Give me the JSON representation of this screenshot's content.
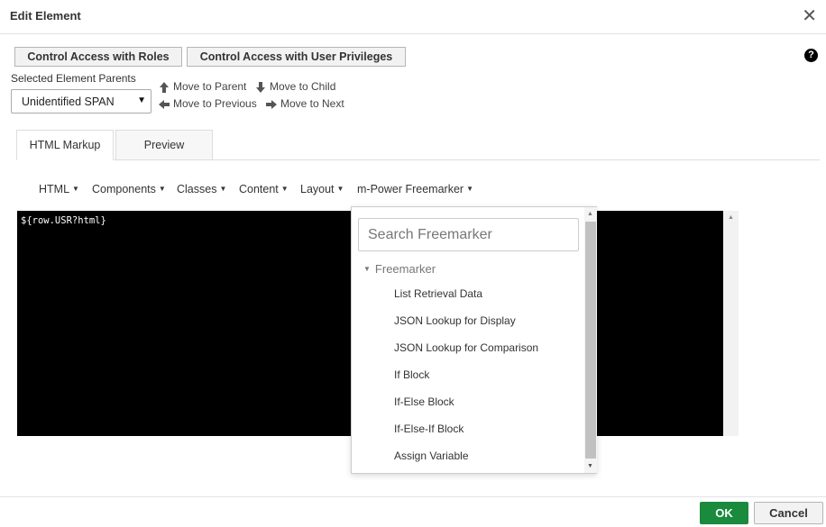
{
  "dialog": {
    "title": "Edit Element",
    "close_glyph": "✕"
  },
  "toolbar": {
    "roles_button": "Control Access with Roles",
    "privileges_button": "Control Access with User Privileges",
    "help_glyph": "?"
  },
  "parents": {
    "label": "Selected Element Parents",
    "selected": "Unidentified SPAN",
    "caret": "▼"
  },
  "moves": {
    "parent": "Move to Parent",
    "child": "Move to Child",
    "previous": "Move to Previous",
    "next": "Move to Next"
  },
  "tabs": {
    "html": "HTML Markup",
    "preview": "Preview",
    "active": "HTML Markup"
  },
  "menubar": {
    "html": "HTML",
    "components": "Components",
    "classes": "Classes",
    "content": "Content",
    "layout": "Layout",
    "freemarker": "m-Power Freemarker",
    "caret": "▼"
  },
  "editor": {
    "code": "${row.USR?html}"
  },
  "dropdown": {
    "search_placeholder": "Search Freemarker",
    "group": "Freemarker",
    "group_caret": "▼",
    "options": [
      "List Retrieval Data",
      "JSON Lookup for Display",
      "JSON Lookup for Comparison",
      "If Block",
      "If-Else Block",
      "If-Else-If Block",
      "Assign Variable"
    ]
  },
  "footer": {
    "ok": "OK",
    "cancel": "Cancel"
  },
  "colors": {
    "ok_green": "#1a8a3c",
    "editor_bg": "#000000"
  }
}
